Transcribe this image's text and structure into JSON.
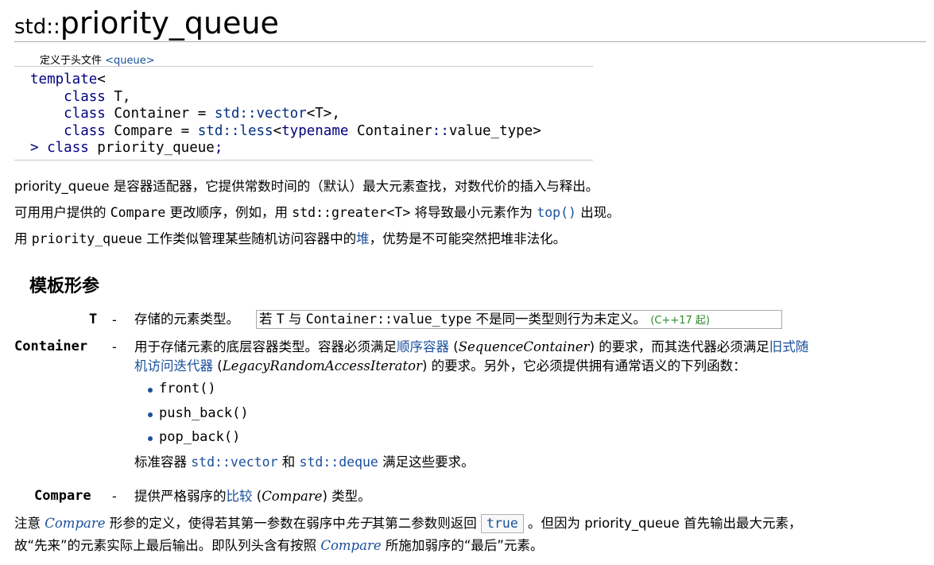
{
  "title": {
    "ns": "std::",
    "name": "priority_queue"
  },
  "header": {
    "label": "定义于头文件 ",
    "file": "<queue>"
  },
  "decl": {
    "l1_kw": "template",
    "l1_op": "<",
    "l2_kw": "class",
    "l2_rest": " T,",
    "l3_kw": "class",
    "l3_rest": " Container = ",
    "l3_id": "std::vector",
    "l3_tail": "<T>,",
    "l4_kw": "class",
    "l4_rest": " Compare = ",
    "l4_id": "std::less",
    "l4_mid": "<",
    "l4_kw2": "typename",
    "l4_tail1": " Container",
    "l4_op": "::",
    "l4_tail2": "value_type>",
    "l5_op": ">",
    "l5_kw": " class",
    "l5_rest": " priority_queue",
    "l5_end": ";"
  },
  "para1": {
    "a": "priority_queue 是容器适配器，它提供常数时间的（默认）最大元素查找，对数代价的插入与释出。"
  },
  "para2": {
    "a": "可用用户提供的 ",
    "code1": "Compare",
    "b": " 更改顺序，例如，用 ",
    "code2": "std::greater<T>",
    "c": " 将导致最小元素作为 ",
    "link": "top()",
    "d": " 出现。"
  },
  "para3": {
    "a": "用 ",
    "code": "priority_queue",
    "b": " 工作类似管理某些随机访问容器中的",
    "link": "堆",
    "c": "，优势是不可能突然把堆非法化。"
  },
  "section": {
    "heading": "模板形参"
  },
  "params": {
    "t": {
      "name": "T",
      "dash": "-",
      "desc": "存储的元素类型。",
      "note_a": "若 ",
      "note_code1": "T",
      "note_b": " 与 ",
      "note_code2": "Container::value_type",
      "note_c": " 不是同一类型则行为未定义。",
      "note_tag": "(C++17 起)"
    },
    "container": {
      "name": "Container",
      "dash": "-",
      "desc_a": "用于存储元素的底层容器类型。容器必须满足",
      "link1": "顺序容器",
      "desc_b": " (",
      "it1": "SequenceContainer",
      "desc_c": ") 的要求，而其迭代器必须满足",
      "link2a": "旧式随",
      "link2b": "机访问迭代器",
      "desc_d": " (",
      "it2": "LegacyRandomAccessIterator",
      "desc_e": ") 的要求。另外，它必须提供拥有通常语义的下列函数：",
      "funcs": [
        "front()",
        "push_back()",
        "pop_back()"
      ],
      "std_a": "标准容器 ",
      "std_code1": "std::vector",
      "std_b": " 和 ",
      "std_code2": "std::deque",
      "std_c": " 满足这些要求。"
    },
    "compare": {
      "name": "Compare",
      "dash": "-",
      "desc_a": "提供严格弱序的",
      "link": "比较",
      "desc_b": " (",
      "it": "Compare",
      "desc_c": ") 类型。"
    }
  },
  "note": {
    "a": "注意 ",
    "it1": "Compare",
    "b": " 形参的定义，使得若其第一参数在弱序中",
    "it2": "先于",
    "c": "其第二参数则返回 ",
    "true": "true",
    "d": " 。但因为 priority_queue 首先输出最大元素，",
    "e": "故“先来”的元素实际上最后输出。即队列头含有按照 ",
    "it3": "Compare",
    "f": " 所施加弱序的“最后”元素。"
  },
  "colors": {
    "link": "#1a4f9c",
    "keyword": "#000080",
    "since_tag": "#2a8a2a"
  }
}
